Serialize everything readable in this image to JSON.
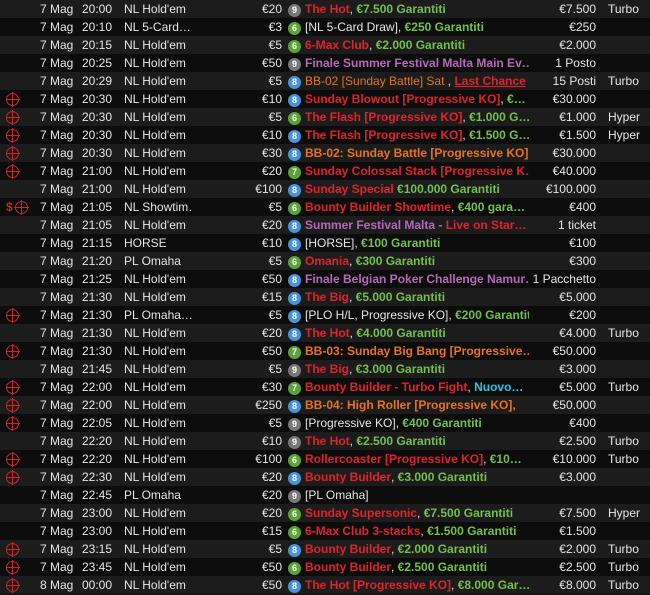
{
  "colors": {
    "red": "#e0232b",
    "orange": "#e8731e",
    "green": "#73c04a",
    "purple": "#b569b8",
    "cyan": "#2ac7e8",
    "badge_blue": "#4a93d9",
    "badge_green": "#5aa437",
    "badge_gray": "#777777"
  },
  "rows": [
    {
      "icons": [],
      "date": "7 Mag",
      "time": "20:00",
      "game": "NL Hold'em",
      "buyin": "€20",
      "badge": "9",
      "badge_color": "gray",
      "parts": [
        {
          "t": "The Hot",
          "c": "red"
        },
        {
          "t": ", ",
          "c": "white"
        },
        {
          "t": "€7.500 Garantiti",
          "c": "green"
        }
      ],
      "gtd": "€7.500",
      "speed": "Turbo"
    },
    {
      "icons": [],
      "date": "7 Mag",
      "time": "20:10",
      "game": "NL 5-Card…",
      "buyin": "€3",
      "badge": "6",
      "badge_color": "green",
      "parts": [
        {
          "t": "[NL 5-Card Draw], ",
          "c": "white"
        },
        {
          "t": "€250 Garantiti",
          "c": "green"
        }
      ],
      "gtd": "€250",
      "speed": ""
    },
    {
      "icons": [],
      "date": "7 Mag",
      "time": "20:15",
      "game": "NL Hold'em",
      "buyin": "€5",
      "badge": "6",
      "badge_color": "green",
      "parts": [
        {
          "t": "6-Max Club",
          "c": "red"
        },
        {
          "t": ", ",
          "c": "white"
        },
        {
          "t": "€2.000 Garantiti",
          "c": "green"
        }
      ],
      "gtd": "€2.000",
      "speed": ""
    },
    {
      "icons": [],
      "date": "7 Mag",
      "time": "20:25",
      "game": "NL Hold'em",
      "buyin": "€50",
      "badge": "9",
      "badge_color": "gray",
      "parts": [
        {
          "t": "Finale Summer Festival Malta Main Ev…",
          "c": "purple"
        }
      ],
      "gtd": "1 Posto",
      "speed": ""
    },
    {
      "icons": [],
      "date": "7 Mag",
      "time": "20:29",
      "game": "NL Hold'em",
      "buyin": "€5",
      "badge": "8",
      "badge_color": "blue",
      "parts": [
        {
          "t": "BB-02 [Sunday Battle] Sat",
          "c": "orange",
          "plain": true
        },
        {
          "t": " , ",
          "c": "white"
        },
        {
          "t": "Last Chance",
          "c": "red",
          "u": true
        }
      ],
      "gtd": "15 Posti",
      "speed": "Turbo"
    },
    {
      "icons": [
        "target"
      ],
      "date": "7 Mag",
      "time": "20:30",
      "game": "NL Hold'em",
      "buyin": "€10",
      "badge": "8",
      "badge_color": "blue",
      "parts": [
        {
          "t": "Sunday Blowout [Progressive KO]",
          "c": "red"
        },
        {
          "t": ", €…",
          "c": "green"
        }
      ],
      "gtd": "€30.000",
      "speed": ""
    },
    {
      "icons": [
        "target"
      ],
      "date": "7 Mag",
      "time": "20:30",
      "game": "NL Hold'em",
      "buyin": "€5",
      "badge": "6",
      "badge_color": "green",
      "parts": [
        {
          "t": "The Flash [Progressive KO]",
          "c": "red"
        },
        {
          "t": ", ",
          "c": "white"
        },
        {
          "t": "€1.000 G…",
          "c": "green"
        }
      ],
      "gtd": "€1.000",
      "speed": "Hyper"
    },
    {
      "icons": [
        "target"
      ],
      "date": "7 Mag",
      "time": "20:30",
      "game": "NL Hold'em",
      "buyin": "€10",
      "badge": "8",
      "badge_color": "blue",
      "parts": [
        {
          "t": "The Flash [Progressive KO]",
          "c": "red"
        },
        {
          "t": ", ",
          "c": "white"
        },
        {
          "t": "€1.500 G…",
          "c": "green"
        }
      ],
      "gtd": "€1.500",
      "speed": "Hyper"
    },
    {
      "icons": [
        "target"
      ],
      "date": "7 Mag",
      "time": "20:30",
      "game": "NL Hold'em",
      "buyin": "€30",
      "badge": "8",
      "badge_color": "blue",
      "parts": [
        {
          "t": "BB-02:  Sunday Battle [Progressive KO],",
          "c": "orange"
        }
      ],
      "gtd": "€30.000",
      "speed": ""
    },
    {
      "icons": [
        "target"
      ],
      "date": "7 Mag",
      "time": "21:00",
      "game": "NL Hold'em",
      "buyin": "€20",
      "badge": "7",
      "badge_color": "green",
      "parts": [
        {
          "t": "Sunday Colossal Stack [Progressive K…",
          "c": "red"
        }
      ],
      "gtd": "€40.000",
      "speed": ""
    },
    {
      "icons": [],
      "date": "7 Mag",
      "time": "21:00",
      "game": "NL Hold'em",
      "buyin": "€100",
      "badge": "8",
      "badge_color": "blue",
      "parts": [
        {
          "t": "Sunday Special",
          "c": "red"
        },
        {
          "t": " ",
          "c": "white"
        },
        {
          "t": "€100.000 Garantiti",
          "c": "green"
        }
      ],
      "gtd": "€100.000",
      "speed": ""
    },
    {
      "icons": [
        "dollar",
        "target"
      ],
      "date": "7 Mag",
      "time": "21:05",
      "game": "NL Showtim…",
      "buyin": "€5",
      "badge": "6",
      "badge_color": "green",
      "parts": [
        {
          "t": "Bounty Builder Showtime",
          "c": "red"
        },
        {
          "t": ", ",
          "c": "white"
        },
        {
          "t": "€400 gara…",
          "c": "green"
        }
      ],
      "gtd": "€400",
      "speed": ""
    },
    {
      "icons": [],
      "date": "7 Mag",
      "time": "21:05",
      "game": "NL Hold'em",
      "buyin": "€20",
      "badge": "8",
      "badge_color": "blue",
      "parts": [
        {
          "t": "Summer Festival Malta - ",
          "c": "purple"
        },
        {
          "t": "Live on Star…",
          "c": "red"
        }
      ],
      "gtd": "1 ticket",
      "speed": ""
    },
    {
      "icons": [],
      "date": "7 Mag",
      "time": "21:15",
      "game": "HORSE",
      "buyin": "€10",
      "badge": "8",
      "badge_color": "blue",
      "parts": [
        {
          "t": "[HORSE], ",
          "c": "white"
        },
        {
          "t": "€100 Garantiti",
          "c": "green"
        }
      ],
      "gtd": "€100",
      "speed": ""
    },
    {
      "icons": [],
      "date": "7 Mag",
      "time": "21:20",
      "game": "PL Omaha",
      "buyin": "€5",
      "badge": "6",
      "badge_color": "green",
      "parts": [
        {
          "t": "Omania",
          "c": "red"
        },
        {
          "t": ", ",
          "c": "white"
        },
        {
          "t": "€300 Garantiti",
          "c": "green"
        }
      ],
      "gtd": "€300",
      "speed": ""
    },
    {
      "icons": [],
      "date": "7 Mag",
      "time": "21:25",
      "game": "NL Hold'em",
      "buyin": "€50",
      "badge": "8",
      "badge_color": "blue",
      "parts": [
        {
          "t": "Finale Belgian Poker Challenge Namur…",
          "c": "purple"
        }
      ],
      "gtd": "1 Pacchetto",
      "speed": ""
    },
    {
      "icons": [],
      "date": "7 Mag",
      "time": "21:30",
      "game": "NL Hold'em",
      "buyin": "€15",
      "badge": "8",
      "badge_color": "blue",
      "parts": [
        {
          "t": "The Big",
          "c": "red"
        },
        {
          "t": ", ",
          "c": "white"
        },
        {
          "t": "€5.000 Garantiti",
          "c": "green"
        }
      ],
      "gtd": "€5.000",
      "speed": ""
    },
    {
      "icons": [
        "target"
      ],
      "date": "7 Mag",
      "time": "21:30",
      "game": "PL Omaha…",
      "buyin": "€5",
      "badge": "8",
      "badge_color": "blue",
      "parts": [
        {
          "t": "[PLO H/L, Progressive KO], ",
          "c": "white"
        },
        {
          "t": "€200 Garantiti",
          "c": "green"
        }
      ],
      "gtd": "€200",
      "speed": ""
    },
    {
      "icons": [],
      "date": "7 Mag",
      "time": "21:30",
      "game": "NL Hold'em",
      "buyin": "€20",
      "badge": "8",
      "badge_color": "blue",
      "parts": [
        {
          "t": "The Hot",
          "c": "red"
        },
        {
          "t": ", ",
          "c": "white"
        },
        {
          "t": "€4.000 Garantiti",
          "c": "green"
        }
      ],
      "gtd": "€4.000",
      "speed": "Turbo"
    },
    {
      "icons": [
        "target"
      ],
      "date": "7 Mag",
      "time": "21:30",
      "game": "NL Hold'em",
      "buyin": "€50",
      "badge": "7",
      "badge_color": "green",
      "parts": [
        {
          "t": "BB-03:  Sunday Big Bang [Progressive…",
          "c": "orange"
        }
      ],
      "gtd": "€50.000",
      "speed": ""
    },
    {
      "icons": [],
      "date": "7 Mag",
      "time": "21:45",
      "game": "NL Hold'em",
      "buyin": "€5",
      "badge": "9",
      "badge_color": "gray",
      "parts": [
        {
          "t": "The Big",
          "c": "red"
        },
        {
          "t": ", ",
          "c": "white"
        },
        {
          "t": "€3.000 Garantiti",
          "c": "green"
        }
      ],
      "gtd": "€3.000",
      "speed": ""
    },
    {
      "icons": [
        "target"
      ],
      "date": "7 Mag",
      "time": "22:00",
      "game": "NL Hold'em",
      "buyin": "€30",
      "badge": "7",
      "badge_color": "green",
      "parts": [
        {
          "t": "Bounty Builder - Turbo Fight",
          "c": "red"
        },
        {
          "t": ", ",
          "c": "white"
        },
        {
          "t": "Nuovo…",
          "c": "cyan"
        }
      ],
      "gtd": "€5.000",
      "speed": "Turbo"
    },
    {
      "icons": [
        "target"
      ],
      "date": "7 Mag",
      "time": "22:00",
      "game": "NL Hold'em",
      "buyin": "€250",
      "badge": "8",
      "badge_color": "blue",
      "parts": [
        {
          "t": "BB-04:  High Roller [Progressive KO],",
          "c": "orange"
        }
      ],
      "gtd": "€50.000",
      "speed": ""
    },
    {
      "icons": [
        "target"
      ],
      "date": "7 Mag",
      "time": "22:05",
      "game": "NL Hold'em",
      "buyin": "€5",
      "badge": "9",
      "badge_color": "gray",
      "parts": [
        {
          "t": "[Progressive KO], ",
          "c": "white"
        },
        {
          "t": "€400 Garantiti",
          "c": "green"
        }
      ],
      "gtd": "€400",
      "speed": ""
    },
    {
      "icons": [],
      "date": "7 Mag",
      "time": "22:20",
      "game": "NL Hold'em",
      "buyin": "€10",
      "badge": "9",
      "badge_color": "gray",
      "parts": [
        {
          "t": "The Hot",
          "c": "red"
        },
        {
          "t": ", ",
          "c": "white"
        },
        {
          "t": "€2.500 Garantiti",
          "c": "green"
        }
      ],
      "gtd": "€2.500",
      "speed": "Turbo"
    },
    {
      "icons": [
        "target"
      ],
      "date": "7 Mag",
      "time": "22:20",
      "game": "NL Hold'em",
      "buyin": "€100",
      "badge": "6",
      "badge_color": "green",
      "parts": [
        {
          "t": "Rollercoaster [Progressive KO]",
          "c": "red"
        },
        {
          "t": ", ",
          "c": "white"
        },
        {
          "t": "€10…",
          "c": "green"
        }
      ],
      "gtd": "€10.000",
      "speed": "Turbo"
    },
    {
      "icons": [
        "target"
      ],
      "date": "7 Mag",
      "time": "22:30",
      "game": "NL Hold'em",
      "buyin": "€20",
      "badge": "8",
      "badge_color": "blue",
      "parts": [
        {
          "t": "Bounty Builder",
          "c": "red"
        },
        {
          "t": ", ",
          "c": "white"
        },
        {
          "t": "€3.000 Garantiti",
          "c": "green"
        }
      ],
      "gtd": "€3.000",
      "speed": ""
    },
    {
      "icons": [],
      "date": "7 Mag",
      "time": "22:45",
      "game": "PL Omaha",
      "buyin": "€20",
      "badge": "9",
      "badge_color": "gray",
      "parts": [
        {
          "t": "[PL Omaha]",
          "c": "white"
        }
      ],
      "gtd": "",
      "speed": ""
    },
    {
      "icons": [],
      "date": "7 Mag",
      "time": "23:00",
      "game": "NL Hold'em",
      "buyin": "€20",
      "badge": "6",
      "badge_color": "green",
      "parts": [
        {
          "t": "Sunday Supersonic",
          "c": "red"
        },
        {
          "t": ", ",
          "c": "white"
        },
        {
          "t": "€7.500 Garantiti",
          "c": "green"
        }
      ],
      "gtd": "€7.500",
      "speed": "Hyper"
    },
    {
      "icons": [],
      "date": "7 Mag",
      "time": "23:00",
      "game": "NL Hold'em",
      "buyin": "€15",
      "badge": "6",
      "badge_color": "green",
      "parts": [
        {
          "t": "6-Max Club 3-stacks",
          "c": "red"
        },
        {
          "t": ", ",
          "c": "white"
        },
        {
          "t": "€1.500 Garantiti",
          "c": "green"
        }
      ],
      "gtd": "€1.500",
      "speed": ""
    },
    {
      "icons": [
        "target"
      ],
      "date": "7 Mag",
      "time": "23:15",
      "game": "NL Hold'em",
      "buyin": "€5",
      "badge": "8",
      "badge_color": "blue",
      "parts": [
        {
          "t": "Bounty Builder",
          "c": "red"
        },
        {
          "t": ", ",
          "c": "white"
        },
        {
          "t": "€2.000 Garantiti",
          "c": "green"
        }
      ],
      "gtd": "€2.000",
      "speed": "Turbo"
    },
    {
      "icons": [
        "target"
      ],
      "date": "7 Mag",
      "time": "23:45",
      "game": "NL Hold'em",
      "buyin": "€50",
      "badge": "6",
      "badge_color": "green",
      "parts": [
        {
          "t": "Bounty Builder",
          "c": "red"
        },
        {
          "t": ", ",
          "c": "white"
        },
        {
          "t": "€2.500 Garantiti",
          "c": "green"
        }
      ],
      "gtd": "€2.500",
      "speed": "Turbo"
    },
    {
      "icons": [
        "target"
      ],
      "date": "8 Mag",
      "time": "00:00",
      "game": "NL Hold'em",
      "buyin": "€50",
      "badge": "8",
      "badge_color": "blue",
      "parts": [
        {
          "t": "The Hot [Progressive KO]",
          "c": "red"
        },
        {
          "t": ", ",
          "c": "white"
        },
        {
          "t": "€8.000 Gar…",
          "c": "green"
        }
      ],
      "gtd": "€8.000",
      "speed": "Turbo"
    }
  ]
}
